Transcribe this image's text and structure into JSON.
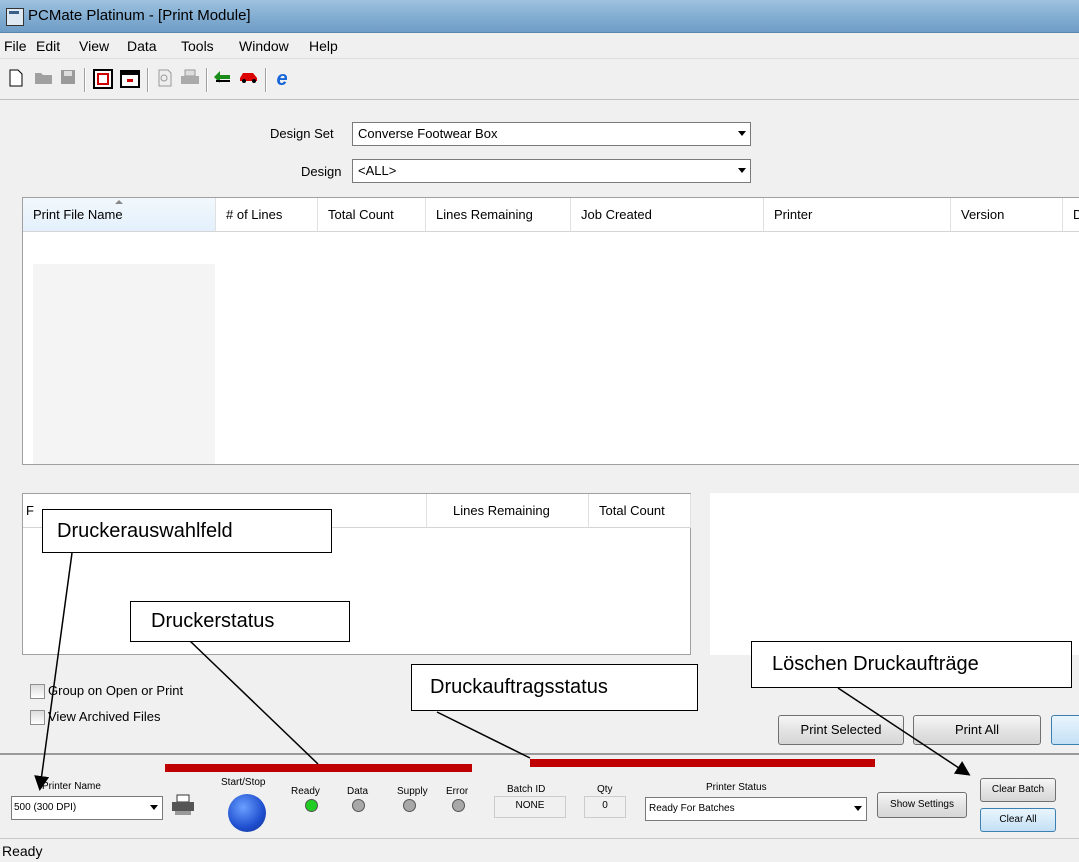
{
  "window": {
    "title": "PCMate Platinum - [Print Module]"
  },
  "menu": [
    "File",
    "Edit",
    "View",
    "Data",
    "Tools",
    "Window",
    "Help"
  ],
  "toolbar_icons": [
    "new-file-icon",
    "open-folder-icon",
    "save-icon",
    "design-icon",
    "form-icon",
    "print-preview-icon",
    "print-icon",
    "import-arrow-icon",
    "car-icon",
    "internet-explorer-icon"
  ],
  "selectors": {
    "design_set_label": "Design Set",
    "design_set_value": "Converse Footwear Box",
    "design_label": "Design",
    "design_value": "<ALL>"
  },
  "grid": {
    "columns": [
      "Print File Name",
      "# of Lines",
      "Total Count",
      "Lines Remaining",
      "Job Created",
      "Printer",
      "Version",
      "D"
    ]
  },
  "lower_list": {
    "columns": [
      "F",
      "Lines Remaining",
      "Total Count"
    ]
  },
  "options": {
    "group_on_open": "Group on Open or Print",
    "view_archived": "View Archived Files"
  },
  "buttons": {
    "print_selected": "Print Selected",
    "print_all": "Print All",
    "show_settings": "Show Settings",
    "clear_batch": "Clear Batch",
    "clear_all": "Clear All"
  },
  "printer_strip": {
    "printer_name_label": "Printer Name",
    "printer_name_value": "500 (300 DPI)",
    "start_stop_label": "Start/Stop",
    "ready_label": "Ready",
    "data_label": "Data",
    "supply_label": "Supply",
    "error_label": "Error",
    "batch_id_label": "Batch ID",
    "batch_id_value": "NONE",
    "qty_label": "Qty",
    "qty_value": "0",
    "printer_status_label": "Printer Status",
    "printer_status_value": "Ready For Batches",
    "ready_led_color": "#22cc22",
    "start_button_color": "#1f4fcf"
  },
  "status_bar": {
    "text": "Ready"
  },
  "annotations": {
    "printer_select": "Druckerauswahlfeld",
    "printer_status": "Druckerstatus",
    "job_status": "Druckauftragsstatus",
    "clear_jobs": "Löschen Druckaufträge",
    "highlight_color": "#c00000"
  }
}
